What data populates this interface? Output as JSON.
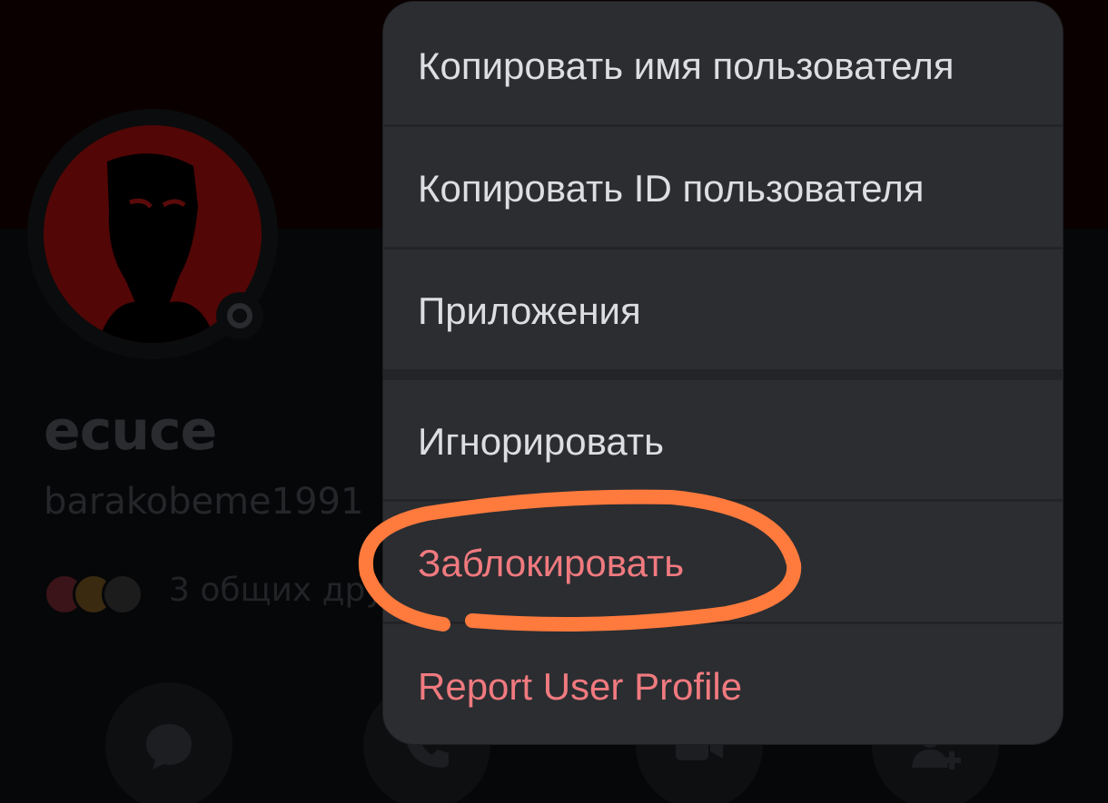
{
  "profile": {
    "display_name": "ecuce",
    "username": "barakobeme1991",
    "mutual_friends_text": "3 общих дру",
    "status_icon": "offline-status-icon"
  },
  "actions": [
    {
      "name": "message-icon"
    },
    {
      "name": "call-icon"
    },
    {
      "name": "video-icon"
    },
    {
      "name": "add-friend-icon"
    }
  ],
  "menu": {
    "items": [
      {
        "label": "Копировать имя пользователя",
        "danger": false
      },
      {
        "label": "Копировать ID пользователя",
        "danger": false
      },
      {
        "label": "Приложения",
        "danger": false
      },
      {
        "label": "Игнорировать",
        "danger": false
      },
      {
        "label": "Заблокировать",
        "danger": true
      },
      {
        "label": "Report User Profile",
        "danger": true
      }
    ]
  },
  "colors": {
    "menu_background": "#2b2d31",
    "menu_text": "#dcdee1",
    "danger_text": "#f07a7f",
    "annotation_stroke": "#ff7a3d"
  }
}
